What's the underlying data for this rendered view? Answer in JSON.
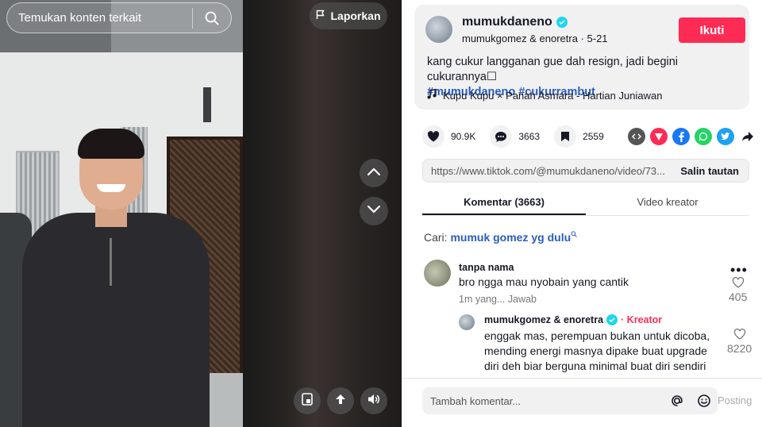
{
  "video": {
    "search_placeholder": "Temukan konten terkait",
    "report_label": "Laporkan"
  },
  "author": {
    "username": "mumukdaneno",
    "subline": "mumukgomez & enoretra · 5-21",
    "follow_label": "Ikuti",
    "description": "kang cukur langganan gue dah resign, jadi begini cukurannya☐",
    "hashtags": [
      "#mumukdaneno",
      "#cukurrambut"
    ],
    "music": "Kupu Kupu × Panah Asmara - Hartian Juniawan"
  },
  "stats": {
    "likes": "90.9K",
    "comments": "3663",
    "saves": "2559"
  },
  "share_colors": {
    "embed": "#555555",
    "send": "#fe2c55",
    "facebook": "#1877f2",
    "whatsapp": "#25d366",
    "twitter": "#1da1f2"
  },
  "link": {
    "url": "https://www.tiktok.com/@mumukdaneno/video/73...",
    "copy_label": "Salin tautan"
  },
  "tabs": [
    "Komentar (3663)",
    "Video kreator"
  ],
  "search_suggestion": {
    "prefix": "Cari:",
    "query": "mumuk gomez yg dulu"
  },
  "comment": {
    "name": "tanpa nama",
    "text": "bro ngga mau nyobain yang cantik",
    "meta": "1m yang... Jawab",
    "likes": "405"
  },
  "reply": {
    "name": "mumukgomez & enoretra",
    "badge": "Kreator",
    "text": "enggak mas, perempuan bukan untuk dicoba, mending energi masnya dipake buat upgrade diri deh biar berguna minimal buat diri sendiri",
    "likes": "8220"
  },
  "composer": {
    "placeholder": "Tambah komentar...",
    "post_label": "Posting"
  }
}
